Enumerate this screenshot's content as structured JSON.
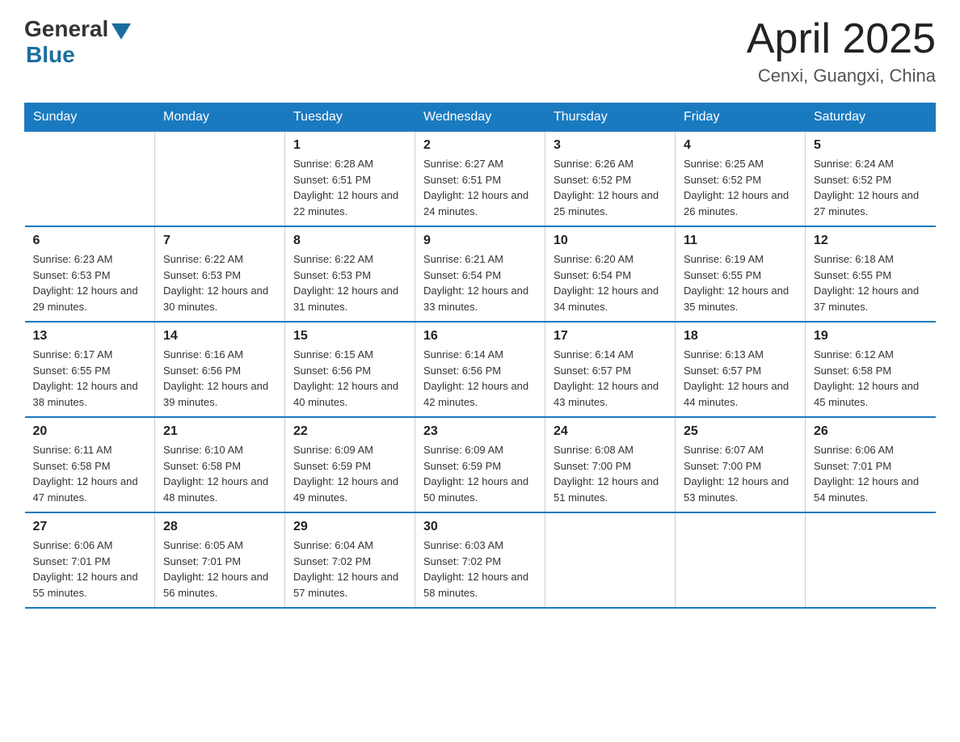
{
  "logo": {
    "general": "General",
    "blue": "Blue"
  },
  "title": "April 2025",
  "subtitle": "Cenxi, Guangxi, China",
  "days_of_week": [
    "Sunday",
    "Monday",
    "Tuesday",
    "Wednesday",
    "Thursday",
    "Friday",
    "Saturday"
  ],
  "weeks": [
    [
      {
        "day": "",
        "info": ""
      },
      {
        "day": "",
        "info": ""
      },
      {
        "day": "1",
        "info": "Sunrise: 6:28 AM\nSunset: 6:51 PM\nDaylight: 12 hours and 22 minutes."
      },
      {
        "day": "2",
        "info": "Sunrise: 6:27 AM\nSunset: 6:51 PM\nDaylight: 12 hours and 24 minutes."
      },
      {
        "day": "3",
        "info": "Sunrise: 6:26 AM\nSunset: 6:52 PM\nDaylight: 12 hours and 25 minutes."
      },
      {
        "day": "4",
        "info": "Sunrise: 6:25 AM\nSunset: 6:52 PM\nDaylight: 12 hours and 26 minutes."
      },
      {
        "day": "5",
        "info": "Sunrise: 6:24 AM\nSunset: 6:52 PM\nDaylight: 12 hours and 27 minutes."
      }
    ],
    [
      {
        "day": "6",
        "info": "Sunrise: 6:23 AM\nSunset: 6:53 PM\nDaylight: 12 hours and 29 minutes."
      },
      {
        "day": "7",
        "info": "Sunrise: 6:22 AM\nSunset: 6:53 PM\nDaylight: 12 hours and 30 minutes."
      },
      {
        "day": "8",
        "info": "Sunrise: 6:22 AM\nSunset: 6:53 PM\nDaylight: 12 hours and 31 minutes."
      },
      {
        "day": "9",
        "info": "Sunrise: 6:21 AM\nSunset: 6:54 PM\nDaylight: 12 hours and 33 minutes."
      },
      {
        "day": "10",
        "info": "Sunrise: 6:20 AM\nSunset: 6:54 PM\nDaylight: 12 hours and 34 minutes."
      },
      {
        "day": "11",
        "info": "Sunrise: 6:19 AM\nSunset: 6:55 PM\nDaylight: 12 hours and 35 minutes."
      },
      {
        "day": "12",
        "info": "Sunrise: 6:18 AM\nSunset: 6:55 PM\nDaylight: 12 hours and 37 minutes."
      }
    ],
    [
      {
        "day": "13",
        "info": "Sunrise: 6:17 AM\nSunset: 6:55 PM\nDaylight: 12 hours and 38 minutes."
      },
      {
        "day": "14",
        "info": "Sunrise: 6:16 AM\nSunset: 6:56 PM\nDaylight: 12 hours and 39 minutes."
      },
      {
        "day": "15",
        "info": "Sunrise: 6:15 AM\nSunset: 6:56 PM\nDaylight: 12 hours and 40 minutes."
      },
      {
        "day": "16",
        "info": "Sunrise: 6:14 AM\nSunset: 6:56 PM\nDaylight: 12 hours and 42 minutes."
      },
      {
        "day": "17",
        "info": "Sunrise: 6:14 AM\nSunset: 6:57 PM\nDaylight: 12 hours and 43 minutes."
      },
      {
        "day": "18",
        "info": "Sunrise: 6:13 AM\nSunset: 6:57 PM\nDaylight: 12 hours and 44 minutes."
      },
      {
        "day": "19",
        "info": "Sunrise: 6:12 AM\nSunset: 6:58 PM\nDaylight: 12 hours and 45 minutes."
      }
    ],
    [
      {
        "day": "20",
        "info": "Sunrise: 6:11 AM\nSunset: 6:58 PM\nDaylight: 12 hours and 47 minutes."
      },
      {
        "day": "21",
        "info": "Sunrise: 6:10 AM\nSunset: 6:58 PM\nDaylight: 12 hours and 48 minutes."
      },
      {
        "day": "22",
        "info": "Sunrise: 6:09 AM\nSunset: 6:59 PM\nDaylight: 12 hours and 49 minutes."
      },
      {
        "day": "23",
        "info": "Sunrise: 6:09 AM\nSunset: 6:59 PM\nDaylight: 12 hours and 50 minutes."
      },
      {
        "day": "24",
        "info": "Sunrise: 6:08 AM\nSunset: 7:00 PM\nDaylight: 12 hours and 51 minutes."
      },
      {
        "day": "25",
        "info": "Sunrise: 6:07 AM\nSunset: 7:00 PM\nDaylight: 12 hours and 53 minutes."
      },
      {
        "day": "26",
        "info": "Sunrise: 6:06 AM\nSunset: 7:01 PM\nDaylight: 12 hours and 54 minutes."
      }
    ],
    [
      {
        "day": "27",
        "info": "Sunrise: 6:06 AM\nSunset: 7:01 PM\nDaylight: 12 hours and 55 minutes."
      },
      {
        "day": "28",
        "info": "Sunrise: 6:05 AM\nSunset: 7:01 PM\nDaylight: 12 hours and 56 minutes."
      },
      {
        "day": "29",
        "info": "Sunrise: 6:04 AM\nSunset: 7:02 PM\nDaylight: 12 hours and 57 minutes."
      },
      {
        "day": "30",
        "info": "Sunrise: 6:03 AM\nSunset: 7:02 PM\nDaylight: 12 hours and 58 minutes."
      },
      {
        "day": "",
        "info": ""
      },
      {
        "day": "",
        "info": ""
      },
      {
        "day": "",
        "info": ""
      }
    ]
  ]
}
